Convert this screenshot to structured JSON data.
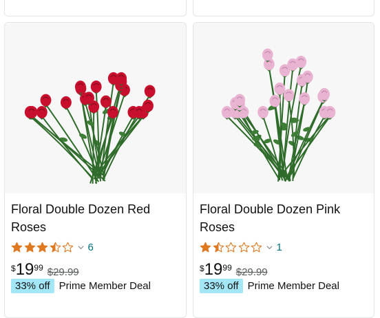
{
  "products": [
    {
      "title": "Floral Double Dozen Red Roses",
      "rating": 3.5,
      "review_count": "6",
      "price_symbol": "$",
      "price_whole": "19",
      "price_fraction": "99",
      "list_price": "$29.99",
      "discount_badge": "33% off",
      "deal_label": "Prime Member Deal",
      "rose_color": "#c8102e",
      "rose_dark": "#8a0a1e",
      "image_desc_icon": "red-roses-bouquet"
    },
    {
      "title": "Floral Double Dozen Pink Roses",
      "rating": 1.5,
      "review_count": "1",
      "price_symbol": "$",
      "price_whole": "19",
      "price_fraction": "99",
      "list_price": "$29.99",
      "discount_badge": "33% off",
      "deal_label": "Prime Member Deal",
      "rose_color": "#e8b4d2",
      "rose_dark": "#c98db2",
      "image_desc_icon": "pink-roses-bouquet"
    }
  ],
  "colors": {
    "star": "#de7921",
    "link": "#007185",
    "badge": "#a3e7f7",
    "stem": "#2f6b2a",
    "leaf": "#3e7d36"
  }
}
